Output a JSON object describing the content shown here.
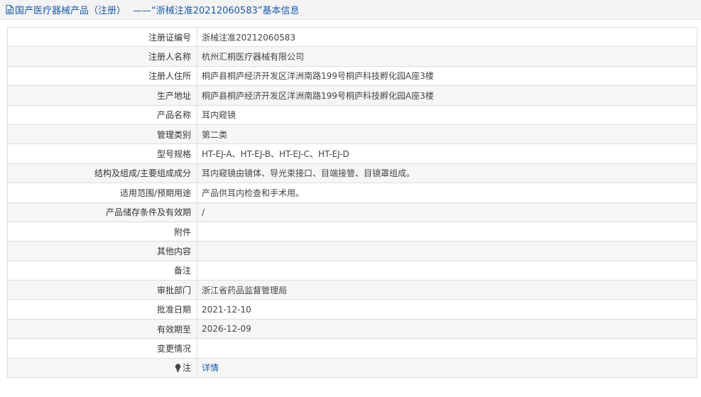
{
  "header": {
    "link_label": "国产医疗器械产品（注册）",
    "title": "——“浙械注准20212060583”基本信息",
    "link_color": "#1a5aa8"
  },
  "rows": [
    {
      "label": "注册证编号",
      "value": "浙械注准20212060583"
    },
    {
      "label": "注册人名称",
      "value": "杭州汇桐医疗器械有限公司"
    },
    {
      "label": "注册人住所",
      "value": "桐庐县桐庐经济开发区洋洲南路199号桐庐科技孵化园A座3楼"
    },
    {
      "label": "生产地址",
      "value": "桐庐县桐庐经济开发区洋洲南路199号桐庐科技孵化园A座3楼"
    },
    {
      "label": "产品名称",
      "value": "耳内窥镜"
    },
    {
      "label": "管理类别",
      "value": "第二类"
    },
    {
      "label": "型号规格",
      "value": "HT-EJ-A、HT-EJ-B、HT-EJ-C、HT-EJ-D"
    },
    {
      "label": "结构及组成/主要组成成分",
      "value": "耳内窥镜由镜体、导光束接口、目端接管、目镜罩组成。"
    },
    {
      "label": "适用范围/预期用途",
      "value": "产品供耳内检查和手术用。"
    },
    {
      "label": "产品储存条件及有效期",
      "value": "/"
    },
    {
      "label": "附件",
      "value": ""
    },
    {
      "label": "其他内容",
      "value": ""
    },
    {
      "label": "备注",
      "value": ""
    },
    {
      "label": "审批部门",
      "value": "浙江省药品监督管理局"
    },
    {
      "label": "批准日期",
      "value": "2021-12-10"
    },
    {
      "label": "有效期至",
      "value": "2026-12-09"
    },
    {
      "label": "变更情况",
      "value": ""
    }
  ],
  "note_row": {
    "icon": "lightbulb-icon",
    "label": "注",
    "link_label": "详情"
  }
}
